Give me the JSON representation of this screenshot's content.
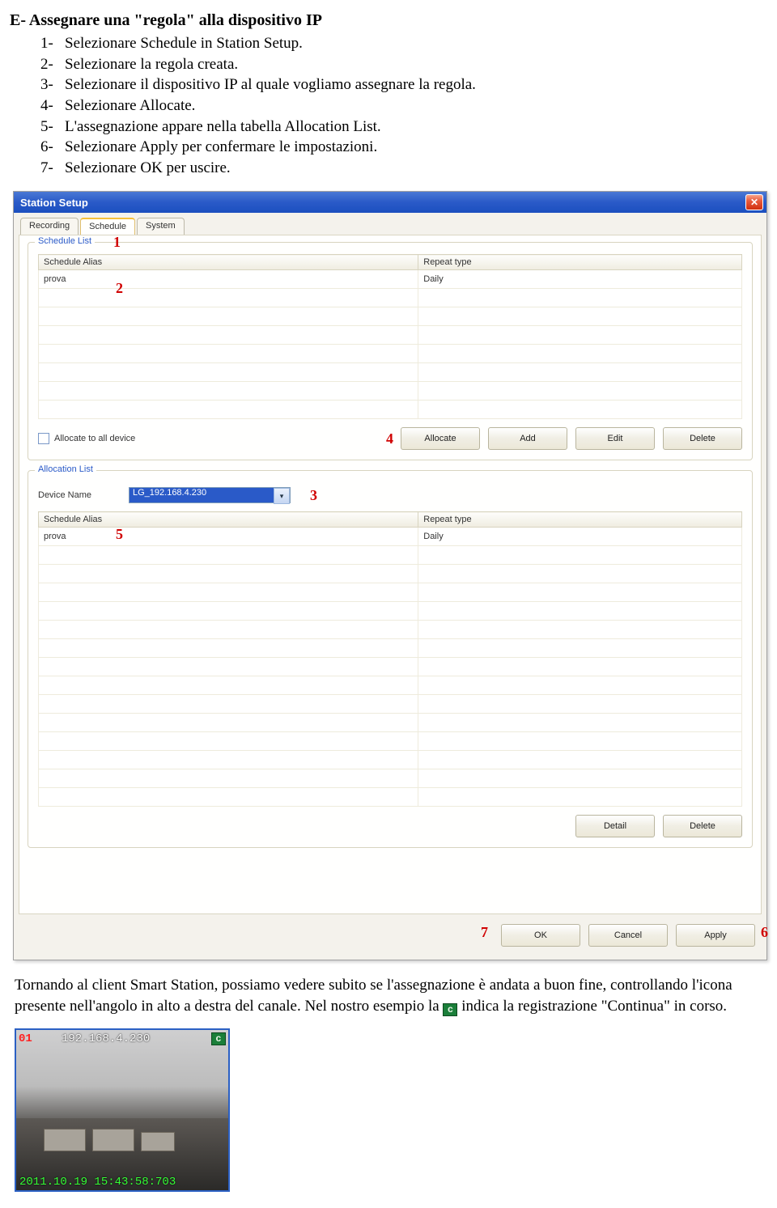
{
  "section": {
    "heading_prefix": "E- ",
    "heading": "Assegnare una \"regola\" alla dispositivo IP",
    "steps": [
      {
        "n": "1-",
        "t": "Selezionare Schedule in Station Setup."
      },
      {
        "n": "2-",
        "t": "Selezionare la regola creata."
      },
      {
        "n": "3-",
        "t": "Selezionare il dispositivo IP al quale vogliamo assegnare la regola."
      },
      {
        "n": "4-",
        "t": "Selezionare Allocate."
      },
      {
        "n": "5-",
        "t": "L'assegnazione appare nella tabella Allocation List."
      },
      {
        "n": "6-",
        "t": "Selezionare Apply per confermare le impostazioni."
      },
      {
        "n": "7-",
        "t": "Selezionare OK per uscire."
      }
    ]
  },
  "dialog": {
    "title": "Station Setup",
    "tabs": [
      "Recording",
      "Schedule",
      "System"
    ],
    "active_tab": 1,
    "schedule_group_title": "Schedule List",
    "alloc_group_title": "Allocation List",
    "columns": [
      "Schedule Alias",
      "Repeat type"
    ],
    "schedule_rows": [
      {
        "alias": "prova",
        "repeat": "Daily"
      }
    ],
    "allocate_all_label": "Allocate to all device",
    "buttons": {
      "allocate": "Allocate",
      "add": "Add",
      "edit": "Edit",
      "delete": "Delete",
      "detail": "Detail",
      "delete2": "Delete",
      "ok": "OK",
      "cancel": "Cancel",
      "apply": "Apply"
    },
    "device_label": "Device Name",
    "device_value": "LG_192.168.4.230",
    "alloc_rows": [
      {
        "alias": "prova",
        "repeat": "Daily"
      }
    ],
    "marks": {
      "m1": "1",
      "m2": "2",
      "m3": "3",
      "m4": "4",
      "m5": "5",
      "m6": "6",
      "m7": "7"
    }
  },
  "after_text": {
    "p1": "Tornando al client Smart Station, possiamo vedere subito se l'assegnazione è andata a buon fine, controllando l'icona presente nell'angolo in alto a destra del canale. Nel nostro esempio la ",
    "p2": " indica la registrazione \"Continua\" in corso.",
    "badge_letter": "c"
  },
  "thumb": {
    "channel": "01",
    "ip": "192.168.4.230",
    "badge": "c",
    "stamp": "2011.10.19 15:43:58:703"
  }
}
